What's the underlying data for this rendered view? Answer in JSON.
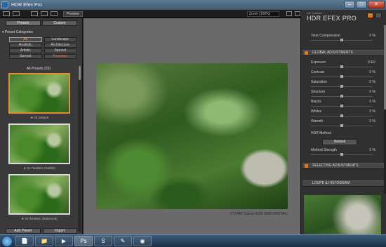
{
  "window": {
    "title": "HDR Efex Pro",
    "btn_minimize": "–",
    "btn_maximize": "□",
    "btn_close": "✕"
  },
  "toolbar": {
    "preview_label": "Preview",
    "zoom_label": "Zoom (100%)"
  },
  "left_panel": {
    "tabs": [
      {
        "label": "Presets"
      },
      {
        "label": "Custom"
      }
    ],
    "categories_heading": "Preset Categories",
    "categories": [
      {
        "label": "All"
      },
      {
        "label": "Landscape"
      },
      {
        "label": "Realistic"
      },
      {
        "label": "Architecture"
      },
      {
        "label": "Artistic"
      },
      {
        "label": "Special"
      },
      {
        "label": "Surreal"
      },
      {
        "label": "Favorites"
      }
    ],
    "all_presets_heading": "All Presets (33)",
    "presets": [
      {
        "label": "★ 00 Default"
      },
      {
        "label": "★ 01 Realistic (Subtle)"
      },
      {
        "label": "★ 02 Realistic (Balanced)"
      }
    ],
    "add_preset_label": "Add Preset",
    "import_label": "Import"
  },
  "center": {
    "photo_info": "(7.9 MP, Canon EOS 350D DIGITAL)"
  },
  "right_panel": {
    "brand_small": "Nik Software",
    "brand_big": "HDR EFEX PRO",
    "tone_compression": {
      "name": "Tone Compression",
      "value": "0 %"
    },
    "global_adjustments_heading": "GLOBAL ADJUSTMENTS",
    "sliders": [
      {
        "name": "Exposure",
        "value": "0 EV"
      },
      {
        "name": "Contrast",
        "value": "0 %"
      },
      {
        "name": "Saturation",
        "value": "0 %"
      },
      {
        "name": "Structure",
        "value": "0 %"
      },
      {
        "name": "Blacks",
        "value": "0 %"
      },
      {
        "name": "Whites",
        "value": "0 %"
      },
      {
        "name": "Warmth",
        "value": "0 %"
      }
    ],
    "hdr_method_label": "HDR Method",
    "hdr_method_value": "Natural",
    "method_strength": {
      "name": "Method Strength",
      "value": "0 %"
    },
    "selective_heading": "SELECTIVE ADJUSTMENTS",
    "loupe_heading": "LOUPE & HISTOGRAM"
  },
  "taskbar": {
    "items": [
      {
        "label": "📄"
      },
      {
        "label": "📁"
      },
      {
        "label": "▶"
      },
      {
        "label": "Ps"
      },
      {
        "label": "S"
      },
      {
        "label": "✎"
      },
      {
        "label": "◉"
      }
    ]
  }
}
